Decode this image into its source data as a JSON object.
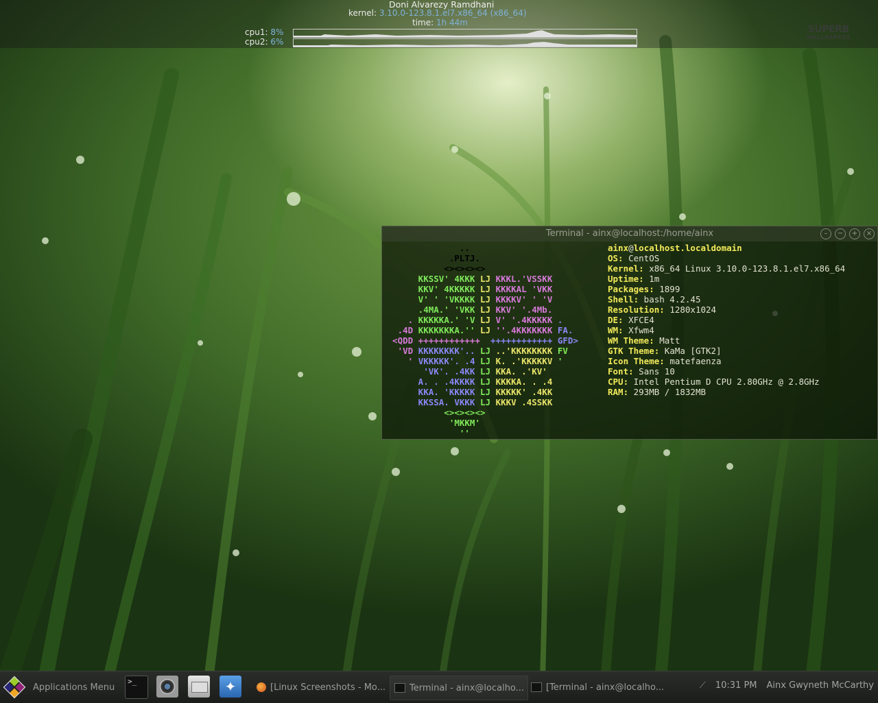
{
  "conky": {
    "user": "Doni Alvarezy Ramdhani",
    "kernel_label": "kernel:",
    "kernel_value": "3.10.0-123.8.1.el7.x86_64 (x86_64)",
    "time_label": "time:",
    "time_value": "1h 44m",
    "cpu1_label": "cpu1:",
    "cpu1_value": "8%",
    "cpu2_label": "cpu2:",
    "cpu2_value": "6%",
    "watermark_top": "SUPERB",
    "watermark_bottom": "WALLPAPERS"
  },
  "terminal": {
    "title": "Terminal - ainx@localhost:/home/ainx",
    "controls": [
      "minimize-icon",
      "restore-icon",
      "maximize-icon",
      "close-icon"
    ],
    "user": "ainx",
    "at": "@",
    "host": "localhost.localdomain",
    "info": [
      {
        "key": "OS:",
        "value": "CentOS"
      },
      {
        "key": "Kernel:",
        "value": "x86_64 Linux 3.10.0-123.8.1.el7.x86_64"
      },
      {
        "key": "Uptime:",
        "value": "1m"
      },
      {
        "key": "Packages:",
        "value": "1899"
      },
      {
        "key": "Shell:",
        "value": "bash 4.2.45"
      },
      {
        "key": "Resolution:",
        "value": "1280x1024"
      },
      {
        "key": "DE:",
        "value": "XFCE4"
      },
      {
        "key": "WM:",
        "value": "Xfwm4"
      },
      {
        "key": "WM Theme:",
        "value": "Matt"
      },
      {
        "key": "GTK Theme:",
        "value": "KaMa [GTK2]"
      },
      {
        "key": "Icon Theme:",
        "value": "matefaenza"
      },
      {
        "key": "Font:",
        "value": "Sans 10"
      },
      {
        "key": "CPU:",
        "value": "Intel Pentium D CPU 2.80GHz @ 2.8GHz"
      },
      {
        "key": "RAM:",
        "value": "293MB / 1832MB"
      }
    ],
    "logo": [
      [
        [
          "",
          "               .."
        ]
      ],
      [
        [
          "",
          "             .PLTJ."
        ]
      ],
      [
        [
          "",
          "            <><><><>"
        ]
      ],
      [
        [
          "g",
          "       KKSSV' 4KKK "
        ],
        [
          "y",
          "LJ "
        ],
        [
          "m",
          "KKKL.'VSSKK"
        ]
      ],
      [
        [
          "g",
          "       KKV' 4KKKKK "
        ],
        [
          "y",
          "LJ "
        ],
        [
          "m",
          "KKKKAL 'VKK"
        ]
      ],
      [
        [
          "g",
          "       V' ' 'VKKKK "
        ],
        [
          "y",
          "LJ "
        ],
        [
          "m",
          "KKKKV' ' 'V"
        ]
      ],
      [
        [
          "g",
          "       .4MA.' 'VKK "
        ],
        [
          "y",
          "LJ "
        ],
        [
          "m",
          "KKV' '.4Mb."
        ]
      ],
      [
        [
          "m",
          "     . "
        ],
        [
          "g",
          "KKKKKA.' 'V "
        ],
        [
          "y",
          "LJ "
        ],
        [
          "m",
          "V' '.4KKKKK "
        ],
        [
          "b",
          "."
        ]
      ],
      [
        [
          "m",
          "   .4D "
        ],
        [
          "g",
          "KKKKKKKA.'' "
        ],
        [
          "y",
          "LJ "
        ],
        [
          "m",
          "''.4KKKKKKK "
        ],
        [
          "b",
          "FA."
        ]
      ],
      [
        [
          "m",
          "  <QDD ++++++++++++  "
        ],
        [
          "b",
          "++++++++++++ GFD>"
        ]
      ],
      [
        [
          "m",
          "   'VD "
        ],
        [
          "b",
          "KKKKKKKK'.. "
        ],
        [
          "g",
          "LJ "
        ],
        [
          "y",
          "..'KKKKKKKK "
        ],
        [
          "g",
          "FV"
        ]
      ],
      [
        [
          "m",
          "     ' "
        ],
        [
          "b",
          "VKKKKK'. .4 "
        ],
        [
          "g",
          "LJ "
        ],
        [
          "y",
          "K. .'KKKKKV "
        ],
        [
          "g",
          "'"
        ]
      ],
      [
        [
          "b",
          "        'VK'. .4KK "
        ],
        [
          "g",
          "LJ "
        ],
        [
          "y",
          "KKA. .'KV'"
        ]
      ],
      [
        [
          "b",
          "       A. . .4KKKK "
        ],
        [
          "g",
          "LJ "
        ],
        [
          "y",
          "KKKKA. . .4"
        ]
      ],
      [
        [
          "b",
          "       KKA. 'KKKKK "
        ],
        [
          "g",
          "LJ "
        ],
        [
          "y",
          "KKKKK' .4KK"
        ]
      ],
      [
        [
          "b",
          "       KKSSA. VKKK "
        ],
        [
          "g",
          "LJ "
        ],
        [
          "y",
          "KKKV .4SSKK"
        ]
      ],
      [
        [
          "g",
          "            <><><><>"
        ]
      ],
      [
        [
          "g",
          "             'MKKM'"
        ]
      ],
      [
        [
          "g",
          "               ''"
        ]
      ]
    ]
  },
  "taskbar": {
    "app_menu_label": "Applications Menu",
    "launchers": [
      "terminal-icon",
      "camera-icon",
      "file-manager-icon",
      "web-browser-icon"
    ],
    "tasks": [
      {
        "label": "[Linux Screenshots - Mo...",
        "icon": "firefox-icon"
      },
      {
        "label": "Terminal - ainx@localho...",
        "icon": "terminal-icon"
      },
      {
        "label": "[Terminal - ainx@localho...",
        "icon": "terminal-icon"
      }
    ],
    "clock": "10:31 PM",
    "username": "Ainx Gwyneth McCarthy"
  }
}
